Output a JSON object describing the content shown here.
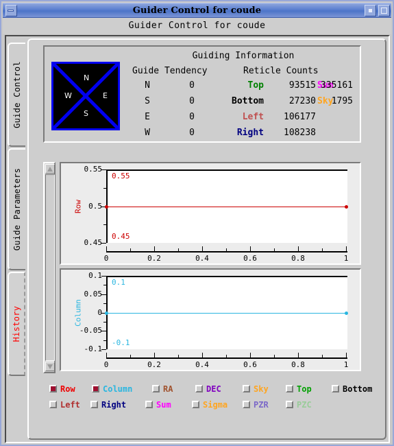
{
  "window": {
    "title": "Guider Control for coude",
    "app_title": "Guider Control for coude",
    "buttons": {
      "minimize": "minimize-icon",
      "restore": "restore-icon",
      "maximize": "maximize-icon"
    }
  },
  "tabs": [
    {
      "label": "Guide Control",
      "selected": false,
      "color": "#000000"
    },
    {
      "label": "Guide Parameters",
      "selected": false,
      "color": "#000000"
    },
    {
      "label": "History",
      "selected": true,
      "color": "#ff0000"
    }
  ],
  "guiding_info": {
    "title": "Guiding Information",
    "compass": {
      "n": "N",
      "s": "S",
      "e": "E",
      "w": "W",
      "border_color": "#0000f0",
      "bg": "#000000"
    },
    "tendency_header": "Guide Tendency",
    "reticle_header": "Reticle Counts",
    "tendency": [
      {
        "dir": "N",
        "value": "0"
      },
      {
        "dir": "S",
        "value": "0"
      },
      {
        "dir": "E",
        "value": "0"
      },
      {
        "dir": "W",
        "value": "0"
      }
    ],
    "reticle": [
      {
        "label": "Top",
        "color": "#008000",
        "value": "93515"
      },
      {
        "label": "Bottom",
        "color": "#000000",
        "value": "27230"
      },
      {
        "label": "Left",
        "color": "#c05050",
        "value": "106177"
      },
      {
        "label": "Right",
        "color": "#000080",
        "value": "108238"
      }
    ],
    "extra": [
      {
        "label": "Sum",
        "color": "#ff00ff",
        "value": "335161"
      },
      {
        "label": "Sky",
        "color": "#ffa520",
        "value": "1795"
      }
    ]
  },
  "chart_data": [
    {
      "type": "line",
      "title": "",
      "ylabel": "Row",
      "xlabel": "",
      "color": "#cc0000",
      "x": [
        0,
        1
      ],
      "values": [
        0.5,
        0.5
      ],
      "xlim": [
        0,
        1
      ],
      "ylim": [
        0.45,
        0.55
      ],
      "xticks": [
        "0",
        "0.2",
        "0.4",
        "0.6",
        "0.8",
        "1"
      ],
      "xtick_values": [
        0,
        0.2,
        0.4,
        0.6,
        0.8,
        1
      ],
      "yticks": [
        "0.55",
        "0.5",
        "0.45"
      ],
      "ytick_values": [
        0.55,
        0.5,
        0.45
      ],
      "annotations": [
        {
          "text": "0.55",
          "color": "#cc0000",
          "position": "top-left"
        },
        {
          "text": "0.45",
          "color": "#cc0000",
          "position": "bottom-left"
        }
      ],
      "grid": false,
      "legend": false
    },
    {
      "type": "line",
      "title": "",
      "ylabel": "Column",
      "xlabel": "",
      "color": "#29b6e0",
      "x": [
        0,
        1
      ],
      "values": [
        0,
        0
      ],
      "xlim": [
        0,
        1
      ],
      "ylim": [
        -0.1,
        0.1
      ],
      "xticks": [
        "0",
        "0.2",
        "0.4",
        "0.6",
        "0.8",
        "1"
      ],
      "xtick_values": [
        0,
        0.2,
        0.4,
        0.6,
        0.8,
        1
      ],
      "yticks": [
        "0.1",
        "0.05",
        "0",
        "-0.05",
        "-0.1"
      ],
      "ytick_values": [
        0.1,
        0.05,
        0,
        -0.05,
        -0.1
      ],
      "annotations": [
        {
          "text": "0.1",
          "color": "#29b6e0",
          "position": "top-left"
        },
        {
          "text": "-0.1",
          "color": "#29b6e0",
          "position": "bottom-left"
        }
      ],
      "grid": false,
      "legend": false
    }
  ],
  "scrollbar": {
    "up": "scroll-up-arrow",
    "down": "scroll-down-arrow"
  },
  "legend": {
    "row1": [
      {
        "label": "Row",
        "color": "#ee0000",
        "checked": true
      },
      {
        "label": "Column",
        "color": "#29b6e0",
        "checked": true
      },
      {
        "label": "RA",
        "color": "#a0522d",
        "checked": false
      },
      {
        "label": "DEC",
        "color": "#8000c0",
        "checked": false
      },
      {
        "label": "Sky",
        "color": "#ffa520",
        "checked": false
      },
      {
        "label": "Top",
        "color": "#00a000",
        "checked": false
      },
      {
        "label": "Bottom",
        "color": "#000000",
        "checked": false
      }
    ],
    "row2": [
      {
        "label": "Left",
        "color": "#b03030",
        "checked": false
      },
      {
        "label": "Right",
        "color": "#000080",
        "checked": false
      },
      {
        "label": "Sum",
        "color": "#ff00ff",
        "checked": false
      },
      {
        "label": "Sigma",
        "color": "#ffa520",
        "checked": false
      },
      {
        "label": "PZR",
        "color": "#7b68c8",
        "checked": false
      },
      {
        "label": "PZC",
        "color": "#99cc99",
        "checked": false
      }
    ]
  }
}
